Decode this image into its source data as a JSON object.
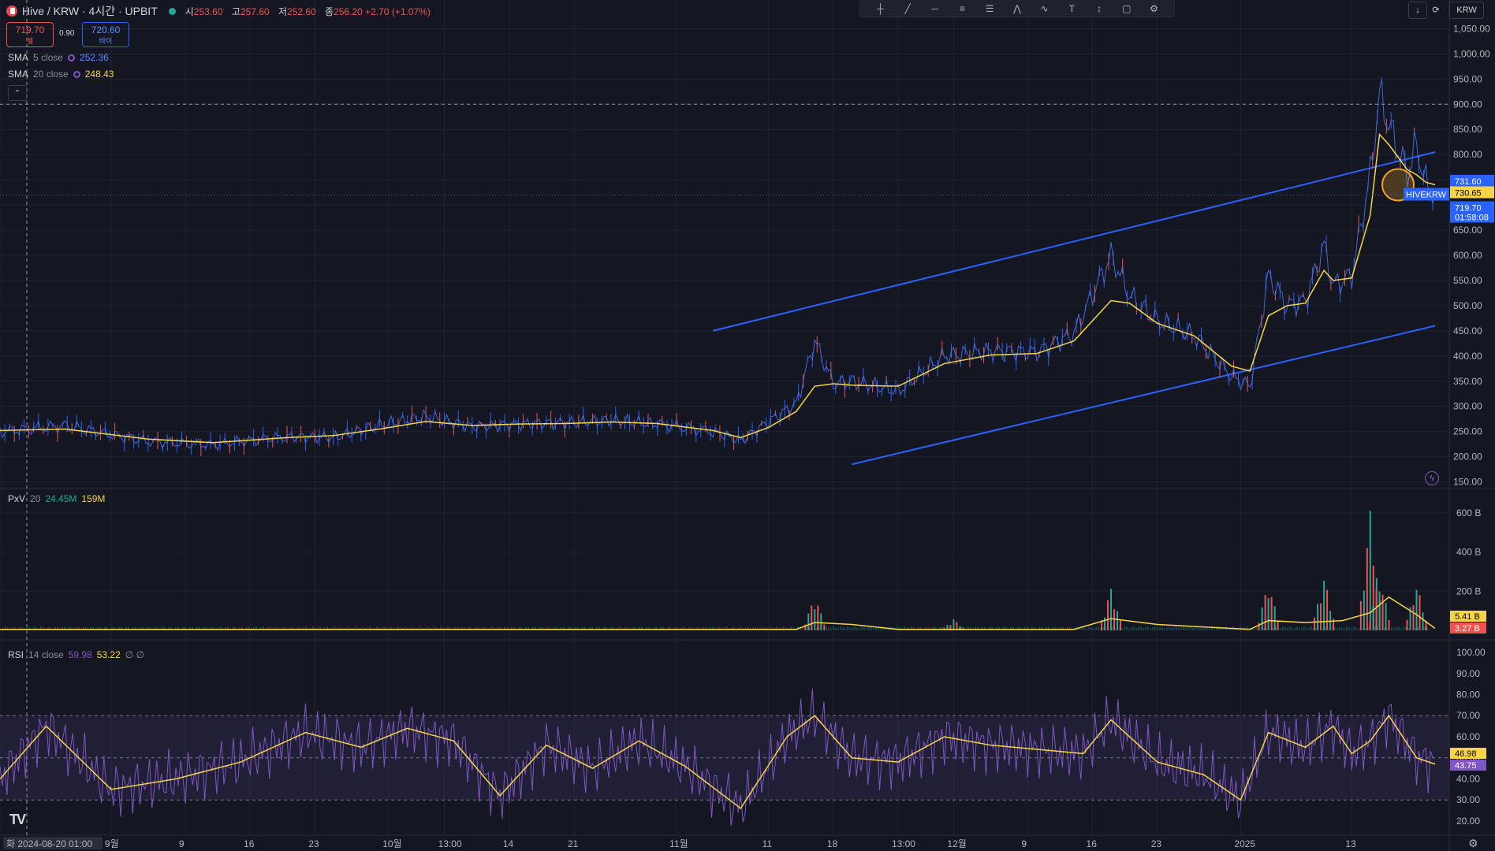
{
  "header": {
    "symbol": "Hive / KRW · 4시간 · UPBIT",
    "ohlc": [
      {
        "label": "시",
        "value": "253.60"
      },
      {
        "label": "고",
        "value": "257.60"
      },
      {
        "label": "저",
        "value": "252.60"
      },
      {
        "label": "종",
        "value": "256.20 +2.70 (+1.07%)"
      }
    ]
  },
  "trade": {
    "sell_price": "719.70",
    "sell_label": "셀",
    "spread": "0.90",
    "buy_price": "720.60",
    "buy_label": "바이"
  },
  "indicators": {
    "sma5": {
      "name": "SMA",
      "param": "5 close",
      "value": "252.36",
      "color": "#5b8cff"
    },
    "sma20": {
      "name": "SMA",
      "param": "20 close",
      "value": "248.43",
      "color": "#f5d547"
    },
    "pxv": {
      "name": "PxV",
      "param": "20",
      "v1": "24.45M",
      "v2": "159M"
    },
    "rsi": {
      "name": "RSI",
      "param": "14 close",
      "v1": "59.98",
      "v2": "53.22",
      "v3": "∅ ∅"
    }
  },
  "toolbar": {
    "icons": [
      "crosshair-icon",
      "trend-line-icon",
      "horizontal-ray-icon",
      "fib-icon",
      "channel-icon",
      "pattern-icon",
      "wave-icon",
      "text-icon",
      "measure-icon",
      "rectangle-icon",
      "gear-icon"
    ]
  },
  "topright": {
    "down_icon": "↓",
    "currency": "KRW"
  },
  "collapse_icon": "⌃",
  "bolt_icon": "ϟ",
  "settings_icon": "⚙",
  "tv_logo": "TV",
  "chart_data": {
    "type": "candlestick",
    "price_axis": {
      "ticks": [
        1050,
        1000,
        950,
        900,
        850,
        800,
        750,
        700,
        650,
        600,
        550,
        500,
        450,
        400,
        350,
        300,
        250,
        200,
        150
      ],
      "tick_labels": [
        "1,050.00",
        "1,000.00",
        "950.00",
        "900.00",
        "850.00",
        "800.00",
        "750.00",
        "700.00",
        "650.00",
        "600.00",
        "550.00",
        "500.00",
        "450.00",
        "400.00",
        "350.00",
        "300.00",
        "250.00",
        "200.00",
        "150.00"
      ],
      "crosshair_value": "900.00"
    },
    "price_tags": [
      {
        "value": 731.6,
        "text": "731.60",
        "color": "#2962ff"
      },
      {
        "value": 730.65,
        "text": "730.65",
        "color": "#f5d547"
      },
      {
        "value": 719.7,
        "text": "719.70",
        "color": "#2962ff"
      }
    ],
    "last_price_time": "01:58:08",
    "symbol_tag": "HIVEKRW",
    "price_series": [
      [
        "2024-08-20",
        250
      ],
      [
        "2024-08-27",
        262
      ],
      [
        "2024-09-05",
        230
      ],
      [
        "2024-09-12",
        224
      ],
      [
        "2024-09-20",
        240
      ],
      [
        "2024-09-25",
        238
      ],
      [
        "2024-09-30",
        262
      ],
      [
        "2024-10-05",
        280
      ],
      [
        "2024-10-10",
        260
      ],
      [
        "2024-10-15",
        265
      ],
      [
        "2024-10-20",
        268
      ],
      [
        "2024-10-25",
        272
      ],
      [
        "2024-10-30",
        265
      ],
      [
        "2024-11-05",
        250
      ],
      [
        "2024-11-08",
        232
      ],
      [
        "2024-11-11",
        270
      ],
      [
        "2024-11-14",
        305
      ],
      [
        "2024-11-16",
        430
      ],
      [
        "2024-11-18",
        345
      ],
      [
        "2024-11-20",
        350
      ],
      [
        "2024-11-25",
        330
      ],
      [
        "2024-11-30",
        400
      ],
      [
        "2024-12-05",
        410
      ],
      [
        "2024-12-10",
        408
      ],
      [
        "2024-12-14",
        445
      ],
      [
        "2024-12-18",
        600
      ],
      [
        "2024-12-20",
        520
      ],
      [
        "2024-12-23",
        470
      ],
      [
        "2024-12-27",
        440
      ],
      [
        "2024-12-31",
        360
      ],
      [
        "2025-01-02",
        340
      ],
      [
        "2025-01-04",
        560
      ],
      [
        "2025-01-06",
        500
      ],
      [
        "2025-01-08",
        510
      ],
      [
        "2025-01-10",
        620
      ],
      [
        "2025-01-11",
        540
      ],
      [
        "2025-01-13",
        560
      ],
      [
        "2025-01-15",
        760
      ],
      [
        "2025-01-16",
        920
      ],
      [
        "2025-01-17",
        860
      ],
      [
        "2025-01-19",
        760
      ],
      [
        "2025-01-20",
        820
      ],
      [
        "2025-01-21",
        740
      ],
      [
        "2025-01-22",
        720
      ]
    ],
    "sma20": [
      [
        "2024-08-20",
        252
      ],
      [
        "2024-08-27",
        255
      ],
      [
        "2024-09-05",
        235
      ],
      [
        "2024-09-12",
        228
      ],
      [
        "2024-09-20",
        238
      ],
      [
        "2024-09-25",
        242
      ],
      [
        "2024-09-30",
        255
      ],
      [
        "2024-10-05",
        270
      ],
      [
        "2024-10-10",
        262
      ],
      [
        "2024-10-15",
        265
      ],
      [
        "2024-10-20",
        266
      ],
      [
        "2024-10-25",
        269
      ],
      [
        "2024-10-30",
        266
      ],
      [
        "2024-11-05",
        252
      ],
      [
        "2024-11-08",
        238
      ],
      [
        "2024-11-11",
        258
      ],
      [
        "2024-11-14",
        290
      ],
      [
        "2024-11-16",
        340
      ],
      [
        "2024-11-18",
        345
      ],
      [
        "2024-11-20",
        342
      ],
      [
        "2024-11-25",
        340
      ],
      [
        "2024-11-30",
        385
      ],
      [
        "2024-12-05",
        402
      ],
      [
        "2024-12-10",
        405
      ],
      [
        "2024-12-14",
        430
      ],
      [
        "2024-12-18",
        510
      ],
      [
        "2024-12-20",
        505
      ],
      [
        "2024-12-23",
        465
      ],
      [
        "2024-12-27",
        440
      ],
      [
        "2024-12-31",
        380
      ],
      [
        "2025-01-02",
        370
      ],
      [
        "2025-01-04",
        480
      ],
      [
        "2025-01-06",
        500
      ],
      [
        "2025-01-08",
        505
      ],
      [
        "2025-01-10",
        570
      ],
      [
        "2025-01-11",
        550
      ],
      [
        "2025-01-13",
        555
      ],
      [
        "2025-01-15",
        680
      ],
      [
        "2025-01-16",
        840
      ],
      [
        "2025-01-17",
        820
      ],
      [
        "2025-01-19",
        770
      ],
      [
        "2025-01-20",
        760
      ],
      [
        "2025-01-21",
        745
      ],
      [
        "2025-01-22",
        740
      ]
    ],
    "channel_upper": [
      [
        "2024-11-05",
        450
      ],
      [
        "2025-01-22",
        805
      ]
    ],
    "channel_lower": [
      [
        "2024-11-20",
        185
      ],
      [
        "2025-01-22",
        460
      ]
    ],
    "volume_axis": {
      "ticks": [
        600,
        400,
        200
      ],
      "tick_labels": [
        "600 B",
        "400 B",
        "200 B"
      ]
    },
    "volume_tags": [
      {
        "text": "5.41 B",
        "color": "#f5d547"
      },
      {
        "text": "3.27 B",
        "color": "#ef5350"
      }
    ],
    "volume_spikes": [
      [
        "2024-11-16",
        180
      ],
      [
        "2024-12-01",
        60
      ],
      [
        "2024-12-18",
        220
      ],
      [
        "2025-01-04",
        250
      ],
      [
        "2025-01-10",
        280
      ],
      [
        "2025-01-15",
        620
      ],
      [
        "2025-01-16",
        280
      ],
      [
        "2025-01-20",
        240
      ]
    ],
    "volume_ma": [
      [
        "2024-08-20",
        5
      ],
      [
        "2024-11-14",
        5
      ],
      [
        "2024-11-16",
        40
      ],
      [
        "2024-11-20",
        30
      ],
      [
        "2024-11-25",
        5
      ],
      [
        "2024-12-14",
        5
      ],
      [
        "2024-12-18",
        60
      ],
      [
        "2024-12-23",
        30
      ],
      [
        "2025-01-02",
        5
      ],
      [
        "2025-01-04",
        50
      ],
      [
        "2025-01-08",
        40
      ],
      [
        "2025-01-12",
        50
      ],
      [
        "2025-01-15",
        90
      ],
      [
        "2025-01-17",
        170
      ],
      [
        "2025-01-20",
        80
      ],
      [
        "2025-01-22",
        10
      ]
    ],
    "rsi_axis": {
      "ticks": [
        100,
        90,
        80,
        70,
        60,
        50,
        40,
        30,
        20
      ],
      "tick_labels": [
        "100.00",
        "90.00",
        "80.00",
        "70.00",
        "60.00",
        "50.00",
        "40.00",
        "30.00",
        "20.00"
      ],
      "band": [
        30,
        70
      ]
    },
    "rsi_tags": [
      {
        "text": "46.98",
        "color": "#f5d547"
      },
      {
        "text": "43.75",
        "color": "#7e57c2"
      }
    ],
    "rsi_ma": [
      [
        "2024-08-20",
        40
      ],
      [
        "2024-08-25",
        65
      ],
      [
        "2024-09-01",
        35
      ],
      [
        "2024-09-08",
        40
      ],
      [
        "2024-09-15",
        48
      ],
      [
        "2024-09-22",
        62
      ],
      [
        "2024-09-28",
        55
      ],
      [
        "2024-10-03",
        64
      ],
      [
        "2024-10-08",
        58
      ],
      [
        "2024-10-13",
        32
      ],
      [
        "2024-10-18",
        56
      ],
      [
        "2024-10-23",
        45
      ],
      [
        "2024-10-28",
        58
      ],
      [
        "2024-11-02",
        46
      ],
      [
        "2024-11-08",
        26
      ],
      [
        "2024-11-13",
        60
      ],
      [
        "2024-11-16",
        70
      ],
      [
        "2024-11-20",
        50
      ],
      [
        "2024-11-25",
        48
      ],
      [
        "2024-11-30",
        60
      ],
      [
        "2024-12-05",
        56
      ],
      [
        "2024-12-10",
        54
      ],
      [
        "2024-12-15",
        52
      ],
      [
        "2024-12-18",
        68
      ],
      [
        "2024-12-23",
        48
      ],
      [
        "2024-12-28",
        42
      ],
      [
        "2025-01-01",
        30
      ],
      [
        "2025-01-04",
        62
      ],
      [
        "2025-01-08",
        55
      ],
      [
        "2025-01-11",
        65
      ],
      [
        "2025-01-13",
        52
      ],
      [
        "2025-01-15",
        58
      ],
      [
        "2025-01-17",
        70
      ],
      [
        "2025-01-20",
        50
      ],
      [
        "2025-01-22",
        47
      ]
    ],
    "x_axis": {
      "labels": [
        "2024-08-20 01:00",
        "9월",
        "9",
        "16",
        "23",
        "10월",
        "13:00",
        "14",
        "21",
        "11월",
        "11",
        "18",
        "13:00",
        "12월",
        "9",
        "16",
        "23",
        "2025",
        "13"
      ],
      "label_dates": [
        "2024-08-20",
        "2024-09-01",
        "2024-09-09",
        "2024-09-16",
        "2024-09-23",
        "2024-10-01",
        "2024-10-07",
        "2024-10-14",
        "2024-10-21",
        "2024-11-01",
        "2024-11-11",
        "2024-11-18",
        "2024-11-25",
        "2024-12-01",
        "2024-12-09",
        "2024-12-16",
        "2024-12-23",
        "2025-01-01",
        "2025-01-13"
      ],
      "cursor_prefix": "화",
      "start": "2024-08-20",
      "end": "2025-01-22"
    }
  }
}
